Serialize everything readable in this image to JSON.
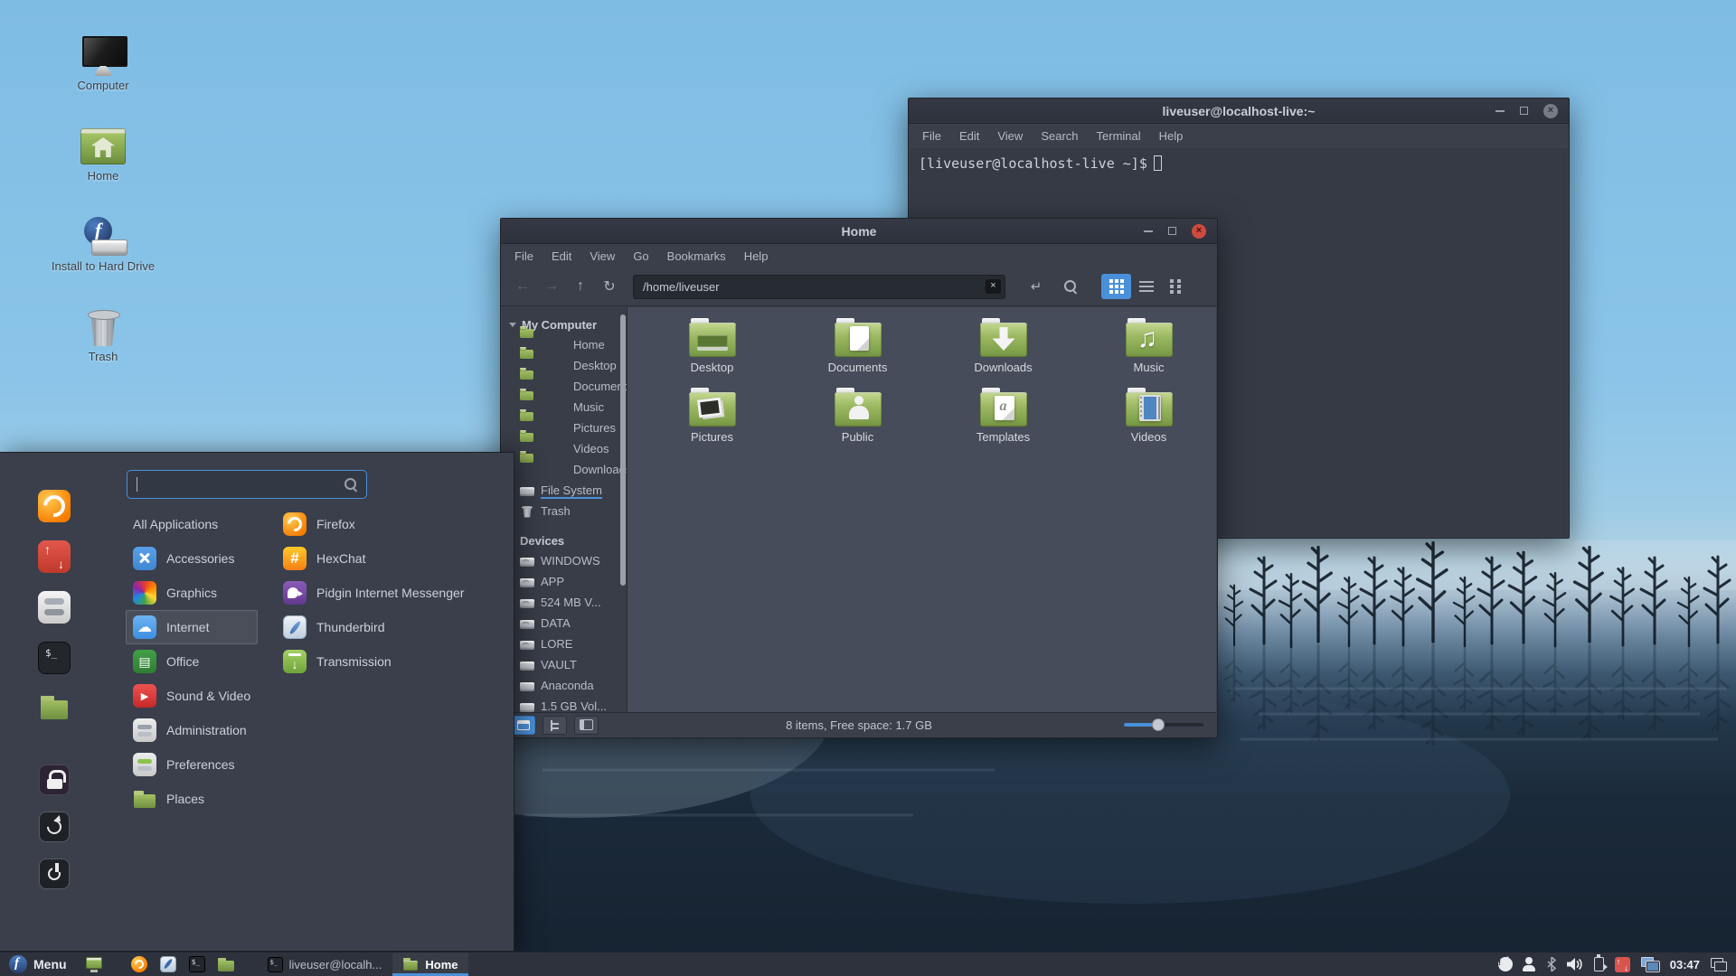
{
  "colors": {
    "accent": "#4a90d9",
    "close_button": "#cf4a3e",
    "folder_green": "#8fae56",
    "sky": "#8ac4e8",
    "water": "#1b2a3a"
  },
  "desktop": {
    "icons": [
      {
        "label": "Computer",
        "icon": "computer"
      },
      {
        "label": "Home",
        "icon": "home"
      },
      {
        "label": "Install to Hard Drive",
        "icon": "installer"
      },
      {
        "label": "Trash",
        "icon": "trash"
      }
    ]
  },
  "terminal": {
    "title": "liveuser@localhost-live:~",
    "menus": [
      "File",
      "Edit",
      "View",
      "Search",
      "Terminal",
      "Help"
    ],
    "prompt": "[liveuser@localhost-live ~]$"
  },
  "file_manager": {
    "title": "Home",
    "menus": [
      "File",
      "Edit",
      "View",
      "Go",
      "Bookmarks",
      "Help"
    ],
    "toolbar": {
      "nav_buttons": [
        {
          "name": "back",
          "disabled": true
        },
        {
          "name": "forward",
          "disabled": true
        },
        {
          "name": "up",
          "disabled": false
        },
        {
          "name": "refresh",
          "disabled": false
        }
      ],
      "path_value": "/home/liveuser",
      "view_buttons": [
        {
          "name": "grid",
          "active": true
        },
        {
          "name": "list",
          "active": false
        },
        {
          "name": "compact",
          "active": false
        }
      ]
    },
    "sidebar": {
      "computer_header": "My Computer",
      "computer_items": [
        {
          "label": "Home",
          "icon": "folder"
        },
        {
          "label": "Desktop",
          "icon": "folder"
        },
        {
          "label": "Documents",
          "icon": "folder"
        },
        {
          "label": "Music",
          "icon": "folder"
        },
        {
          "label": "Pictures",
          "icon": "folder"
        },
        {
          "label": "Videos",
          "icon": "folder"
        },
        {
          "label": "Downloads",
          "icon": "folder"
        },
        {
          "label": "File System",
          "icon": "filesystem",
          "drop_target": true
        },
        {
          "label": "Trash",
          "icon": "trash"
        }
      ],
      "devices_header": "Devices",
      "device_items": [
        {
          "label": "WINDOWS",
          "icon": "drive"
        },
        {
          "label": "APP",
          "icon": "drive"
        },
        {
          "label": "524 MB V...",
          "icon": "drive"
        },
        {
          "label": "DATA",
          "icon": "drive"
        },
        {
          "label": "LORE",
          "icon": "drive"
        },
        {
          "label": "VAULT",
          "icon": "drive-plain"
        },
        {
          "label": "Anaconda",
          "icon": "drive-plain"
        },
        {
          "label": "1.5 GB Vol...",
          "icon": "drive-plain"
        }
      ]
    },
    "folders": [
      {
        "label": "Desktop",
        "emblem": "desktop"
      },
      {
        "label": "Documents",
        "emblem": "documents"
      },
      {
        "label": "Downloads",
        "emblem": "downloads"
      },
      {
        "label": "Music",
        "emblem": "music"
      },
      {
        "label": "Pictures",
        "emblem": "pictures"
      },
      {
        "label": "Public",
        "emblem": "public"
      },
      {
        "label": "Templates",
        "emblem": "templates"
      },
      {
        "label": "Videos",
        "emblem": "videos"
      }
    ],
    "statusbar": {
      "buttons": [
        {
          "name": "places",
          "active": true
        },
        {
          "name": "tree",
          "active": false
        },
        {
          "name": "toggle-sidebar",
          "active": false
        }
      ],
      "text": "8 items, Free space: 1.7 GB"
    }
  },
  "menu": {
    "search_value": "",
    "categories": [
      {
        "label": "All Applications",
        "icon": "none",
        "selected": false
      },
      {
        "label": "Accessories",
        "icon": "accessories",
        "selected": false
      },
      {
        "label": "Graphics",
        "icon": "graphics",
        "selected": false
      },
      {
        "label": "Internet",
        "icon": "internet",
        "selected": true
      },
      {
        "label": "Office",
        "icon": "office",
        "selected": false
      },
      {
        "label": "Sound & Video",
        "icon": "sound",
        "selected": false
      },
      {
        "label": "Administration",
        "icon": "admin",
        "selected": false
      },
      {
        "label": "Preferences",
        "icon": "prefs",
        "selected": false
      },
      {
        "label": "Places",
        "icon": "places",
        "selected": false
      }
    ],
    "apps": [
      {
        "label": "Firefox",
        "icon": "firefox"
      },
      {
        "label": "HexChat",
        "icon": "hexchat"
      },
      {
        "label": "Pidgin Internet Messenger",
        "icon": "pidgin"
      },
      {
        "label": "Thunderbird",
        "icon": "thunderbird"
      },
      {
        "label": "Transmission",
        "icon": "transmission"
      }
    ],
    "favorites": [
      {
        "name": "firefox"
      },
      {
        "name": "software-installer"
      },
      {
        "name": "settings"
      },
      {
        "name": "terminal"
      },
      {
        "name": "files"
      }
    ],
    "session": [
      {
        "name": "lock"
      },
      {
        "name": "logout"
      },
      {
        "name": "shutdown"
      }
    ]
  },
  "taskbar": {
    "menu_label": "Menu",
    "launchers": [
      {
        "name": "show-desktop"
      },
      {
        "name": "firefox"
      },
      {
        "name": "thunderbird"
      },
      {
        "name": "terminal"
      },
      {
        "name": "files"
      }
    ],
    "windows": [
      {
        "title": "liveuser@localh...",
        "icon": "terminal",
        "active": false
      },
      {
        "title": "Home",
        "icon": "folder",
        "active": true
      }
    ],
    "tray": {
      "icons": [
        "notifications",
        "user",
        "bluetooth",
        "volume",
        "battery",
        "updates",
        "network",
        "workspaces"
      ],
      "notification_count": "1",
      "clock": "03:47"
    }
  }
}
